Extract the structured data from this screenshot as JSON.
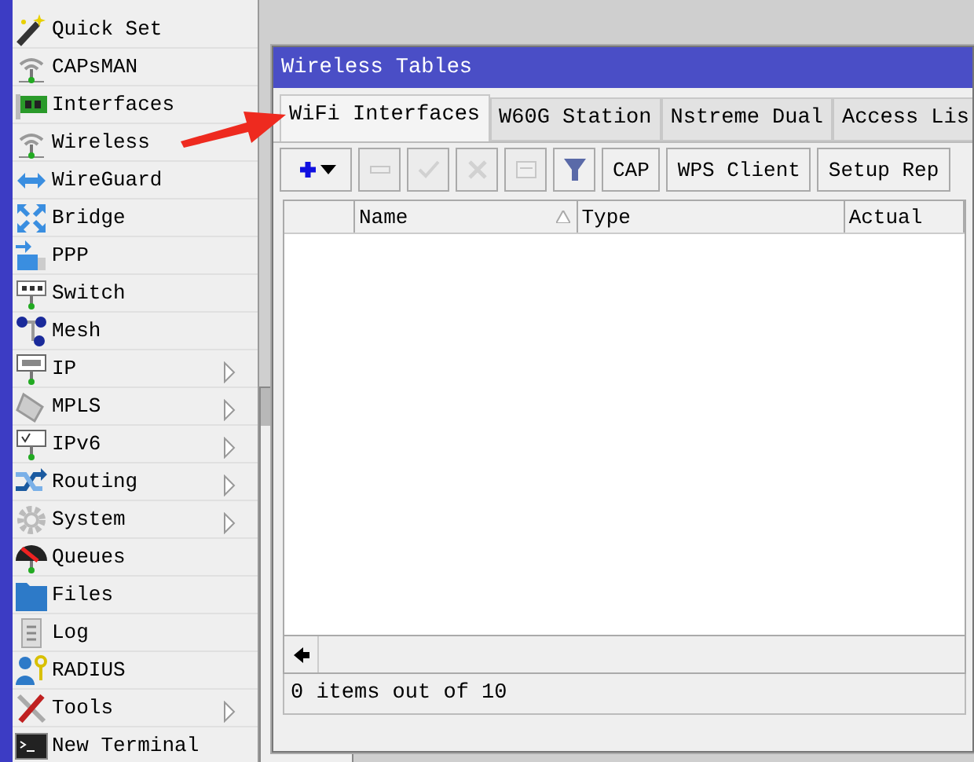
{
  "menu": {
    "items": [
      {
        "label": "Quick Set",
        "has_submenu": false
      },
      {
        "label": "CAPsMAN",
        "has_submenu": false
      },
      {
        "label": "Interfaces",
        "has_submenu": false
      },
      {
        "label": "Wireless",
        "has_submenu": false
      },
      {
        "label": "WireGuard",
        "has_submenu": false
      },
      {
        "label": "Bridge",
        "has_submenu": false
      },
      {
        "label": "PPP",
        "has_submenu": false
      },
      {
        "label": "Switch",
        "has_submenu": false
      },
      {
        "label": "Mesh",
        "has_submenu": false
      },
      {
        "label": "IP",
        "has_submenu": true
      },
      {
        "label": "MPLS",
        "has_submenu": true
      },
      {
        "label": "IPv6",
        "has_submenu": true
      },
      {
        "label": "Routing",
        "has_submenu": true
      },
      {
        "label": "System",
        "has_submenu": true
      },
      {
        "label": "Queues",
        "has_submenu": false
      },
      {
        "label": "Files",
        "has_submenu": false
      },
      {
        "label": "Log",
        "has_submenu": false
      },
      {
        "label": "RADIUS",
        "has_submenu": false
      },
      {
        "label": "Tools",
        "has_submenu": true
      },
      {
        "label": "New Terminal",
        "has_submenu": false
      }
    ]
  },
  "window": {
    "title": "Wireless Tables",
    "tabs": [
      {
        "label": "WiFi Interfaces",
        "selected": true
      },
      {
        "label": "W60G Station",
        "selected": false
      },
      {
        "label": "Nstreme Dual",
        "selected": false
      },
      {
        "label": "Access Lis",
        "selected": false
      }
    ],
    "toolbar": [
      {
        "kind": "add",
        "disabled": false
      },
      {
        "kind": "remove",
        "disabled": true
      },
      {
        "kind": "enable",
        "disabled": true
      },
      {
        "kind": "disable",
        "disabled": true
      },
      {
        "kind": "comment",
        "disabled": true
      },
      {
        "kind": "filter",
        "disabled": false
      },
      {
        "kind": "text",
        "label": "CAP"
      },
      {
        "kind": "text",
        "label": "WPS Client"
      },
      {
        "kind": "text",
        "label": "Setup Rep"
      }
    ],
    "table": {
      "columns": [
        "",
        "Name",
        "Type",
        "Actual"
      ]
    },
    "status_bar": "0 items out of 10"
  }
}
